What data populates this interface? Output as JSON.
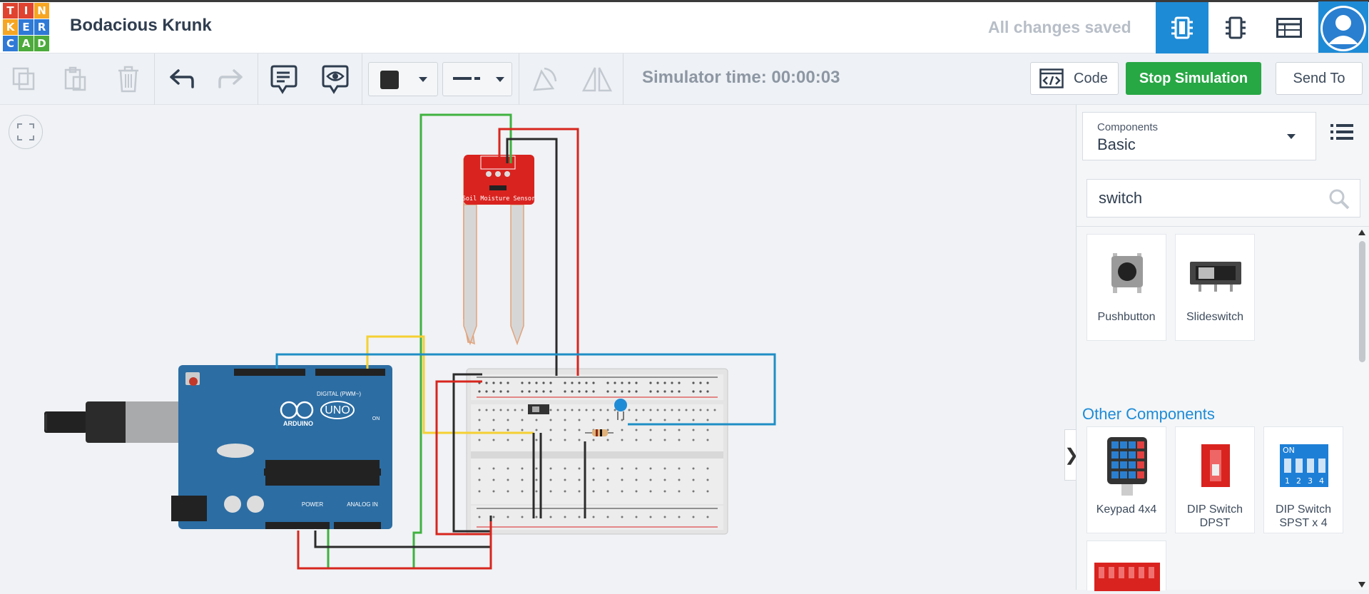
{
  "app": {
    "logo_letters": [
      "T",
      "I",
      "N",
      "K",
      "E",
      "R",
      "C",
      "A",
      "D"
    ],
    "logo_colors": [
      "#e0432f",
      "#e0432f",
      "#f6a623",
      "#f6a623",
      "#2f7ad6",
      "#2f7ad6",
      "#2f7ad6",
      "#4cab3c",
      "#4cab3c"
    ],
    "project_title": "Bodacious Krunk",
    "save_status": "All changes saved",
    "accent": "#1e8bd6"
  },
  "header_views": [
    {
      "name": "circuit-view",
      "icon": "breadboard-icon",
      "active": true
    },
    {
      "name": "schematic-view",
      "icon": "chip-icon",
      "active": false
    },
    {
      "name": "component-list-view",
      "icon": "table-icon",
      "active": false
    }
  ],
  "toolbar": {
    "simulator_time": "Simulator time: 00:00:03",
    "code_label": "Code",
    "stop_label": "Stop Simulation",
    "send_label": "Send To",
    "stop_color": "#28a745",
    "wire_color": "#2b2b2b"
  },
  "panel": {
    "components_label": "Components",
    "category": "Basic",
    "search_value": "switch",
    "search_placeholder": "Search",
    "results": [
      {
        "label": "Pushbutton"
      },
      {
        "label": "Slideswitch"
      }
    ],
    "other_heading": "Other Components",
    "other": [
      {
        "label1": "Keypad 4x4",
        "label2": ""
      },
      {
        "label1": "DIP Switch",
        "label2": "DPST"
      },
      {
        "label1": "DIP Switch",
        "label2": "SPST x 4"
      }
    ]
  },
  "circuit": {
    "arduino": {
      "brand": "ARDUINO",
      "model": "UNO",
      "digital_label": "DIGITAL (PWM~)",
      "power_label": "POWER",
      "analog_label": "ANALOG IN",
      "on_label": "ON"
    },
    "sensor": {
      "label": "Soil Moisture Sensor"
    }
  }
}
